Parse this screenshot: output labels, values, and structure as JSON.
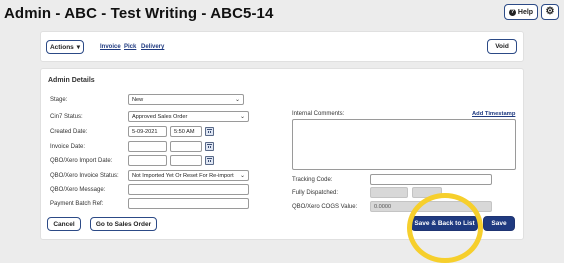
{
  "page": {
    "title": "Admin - ABC - Test Writing  - ABC5-14",
    "help_label": "Help",
    "settings_icon": "gear-icon",
    "help_icon": "question-circle-icon"
  },
  "toolbar": {
    "actions_label": "Actions",
    "actions_caret": "▾",
    "links": [
      "Invoice",
      "Pick",
      "Delivery"
    ],
    "void_label": "Void"
  },
  "admin_details": {
    "heading": "Admin Details",
    "stage": {
      "label": "Stage:",
      "value": "New"
    },
    "cin7_status": {
      "label": "Cin7 Status:",
      "value": "Approved Sales Order"
    },
    "created_date": {
      "label": "Created Date:",
      "date": "5-09-2021",
      "time": "5:50 AM"
    },
    "invoice_date": {
      "label": "Invoice Date:",
      "date": "",
      "time": ""
    },
    "import_date": {
      "label": "QBO/Xero Import Date:",
      "date": "",
      "time": ""
    },
    "invoice_status": {
      "label": "QBO/Xero Invoice Status:",
      "value": "Not Imported Yet Or Reset For Re-import"
    },
    "xero_message": {
      "label": "QBO/Xero Message:",
      "value": ""
    },
    "payment_ref": {
      "label": "Payment Batch Ref:",
      "value": ""
    },
    "internal_comments": {
      "label": "Internal Comments:",
      "value": ""
    },
    "add_timestamp": "Add Timestamp",
    "tracking_code": {
      "label": "Tracking Code:",
      "value": ""
    },
    "fully_dispatched": {
      "label": "Fully Dispatched:"
    },
    "cogs_value": {
      "label": "QBO/Xero COGS Value:",
      "value": "0.0000"
    }
  },
  "footer": {
    "cancel_label": "Cancel",
    "goto_label": "Go to Sales Order",
    "save_back_label": "Save & Back to List",
    "save_label": "Save"
  },
  "colors": {
    "accent": "#1f3a80",
    "highlight_ring": "#f6cf2c",
    "page_bg": "#ececec"
  }
}
